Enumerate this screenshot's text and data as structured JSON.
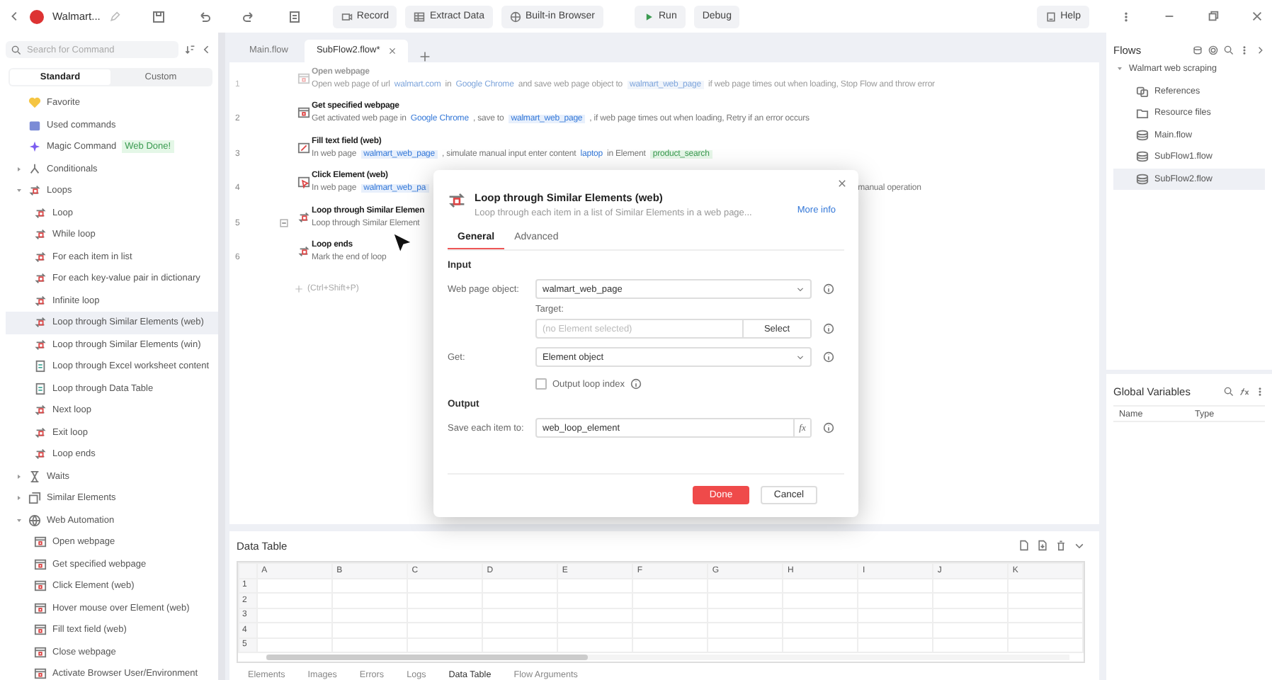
{
  "toolbar": {
    "title": "Walmart...",
    "buttons": [
      {
        "label": "Record",
        "kind": "record"
      },
      {
        "label": "Extract Data",
        "kind": "extract"
      },
      {
        "label": "Built-in Browser",
        "kind": "browser"
      },
      {
        "label": "Run",
        "kind": "run"
      },
      {
        "label": "Debug",
        "kind": "debug"
      }
    ],
    "help": "Help"
  },
  "sidebar": {
    "search": {
      "placeholder": "Search for Command"
    },
    "tabs": [
      {
        "label": "Standard",
        "selected": true
      },
      {
        "label": "Custom",
        "selected": false
      }
    ],
    "items": [
      {
        "kind": "entry",
        "label": "Favorite"
      },
      {
        "kind": "entry",
        "label": "Used commands"
      },
      {
        "kind": "entry",
        "label": "Magic Command",
        "badge": "Web Done!"
      },
      {
        "kind": "group",
        "label": "Conditionals",
        "expanded": false
      },
      {
        "kind": "group",
        "label": "Loops",
        "expanded": true,
        "children": [
          {
            "label": "Loop",
            "selected": false
          },
          {
            "label": "While loop",
            "selected": false
          },
          {
            "label": "For each item in list",
            "selected": false
          },
          {
            "label": "For each key-value pair in dictionary",
            "selected": false
          },
          {
            "label": "Infinite loop",
            "selected": false
          },
          {
            "label": "Loop through Similar Elements (web)",
            "selected": true
          },
          {
            "label": "Loop through Similar Elements (win)",
            "selected": false
          },
          {
            "label": "Loop through Excel worksheet content",
            "selected": false
          },
          {
            "label": "Loop through Data Table",
            "selected": false
          },
          {
            "label": "Next loop",
            "selected": false
          },
          {
            "label": "Exit loop",
            "selected": false
          },
          {
            "label": "Loop ends",
            "selected": false
          }
        ]
      },
      {
        "kind": "group",
        "label": "Waits",
        "expanded": false
      },
      {
        "kind": "group",
        "label": "Similar Elements",
        "expanded": false
      },
      {
        "kind": "group",
        "label": "Web Automation",
        "expanded": true,
        "children": [
          {
            "label": "Open webpage",
            "selected": false
          },
          {
            "label": "Get specified webpage",
            "selected": false
          },
          {
            "label": "Click Element (web)",
            "selected": false
          },
          {
            "label": "Hover mouse over Element (web)",
            "selected": false
          },
          {
            "label": "Fill text field (web)",
            "selected": false
          },
          {
            "label": "Close webpage",
            "selected": false
          },
          {
            "label": "Activate Browser User/Environment",
            "selected": false
          }
        ]
      }
    ]
  },
  "editor": {
    "tabs": [
      {
        "label": "Main.flow",
        "selected": false
      },
      {
        "label": "SubFlow2.flow*",
        "selected": true
      }
    ],
    "steps": [
      {
        "number": "1",
        "title": "Open webpage",
        "disabled": true,
        "parts": [
          {
            "kind": "text",
            "text": "Open web page of url"
          },
          {
            "kind": "link",
            "text": "walmart.com"
          },
          {
            "kind": "text",
            "text": "in"
          },
          {
            "kind": "link",
            "text": "Google Chrome"
          },
          {
            "kind": "text",
            "text": "and save web page object to"
          },
          {
            "kind": "var",
            "text": "walmart_web_page"
          },
          {
            "kind": "text",
            "text": "if web page times out when loading, Stop Flow and throw error"
          }
        ]
      },
      {
        "number": "2",
        "title": "Get specified webpage",
        "disabled": false,
        "parts": [
          {
            "kind": "text",
            "text": "Get activated web page in"
          },
          {
            "kind": "link",
            "text": "Google Chrome"
          },
          {
            "kind": "text",
            "text": ", save to"
          },
          {
            "kind": "var",
            "text": "walmart_web_page"
          },
          {
            "kind": "text",
            "text": ", if web page times out when loading, Retry if an error occurs"
          }
        ]
      },
      {
        "number": "3",
        "title": "Fill text field (web)",
        "disabled": false,
        "parts": [
          {
            "kind": "text",
            "text": "In web page"
          },
          {
            "kind": "var",
            "text": "walmart_web_page"
          },
          {
            "kind": "text",
            "text": ", simulate manual input enter content"
          },
          {
            "kind": "link",
            "text": "laptop"
          },
          {
            "kind": "text",
            "text": "in Element"
          },
          {
            "kind": "element",
            "text": "product_search"
          }
        ]
      },
      {
        "number": "4",
        "title": "Click Element (web)",
        "disabled": false,
        "parts": [
          {
            "kind": "text",
            "text": "In web page"
          },
          {
            "kind": "var",
            "text": "walmart_web_pa"
          },
          {
            "kind": "tail",
            "text": "manual operation"
          }
        ]
      },
      {
        "number": "5",
        "title": "Loop through Similar Elemen",
        "disabled": false,
        "expanded": true,
        "parts": [
          {
            "kind": "text",
            "text": "Loop through Similar Element"
          }
        ]
      },
      {
        "number": "6",
        "title": "Loop ends",
        "disabled": false,
        "parts": [
          {
            "kind": "text",
            "text": "Mark the end of loop"
          }
        ]
      }
    ],
    "add_hint": "(Ctrl+Shift+P)"
  },
  "dialog": {
    "title": "Loop through Similar Elements (web)",
    "subtitle": "Loop through each item in a list of Similar Elements in a web page...",
    "more_info": "More info",
    "tabs": [
      {
        "label": "General",
        "selected": true
      },
      {
        "label": "Advanced",
        "selected": false
      }
    ],
    "input_section": "Input",
    "web_page_object": {
      "label": "Web page object:",
      "value": "walmart_web_page"
    },
    "target": {
      "label": "Target:",
      "placeholder": "(no Element selected)",
      "button": "Select"
    },
    "get": {
      "label": "Get:",
      "value": "Element object"
    },
    "output_loop_index": {
      "label": "Output loop index",
      "checked": false
    },
    "output_section": "Output",
    "save_to": {
      "label": "Save each item to:",
      "value": "web_loop_element",
      "fx": "fx"
    },
    "buttons": {
      "done": "Done",
      "cancel": "Cancel"
    }
  },
  "bottom_panel": {
    "title": "Data Table",
    "table": {
      "columns": [
        "A",
        "B",
        "C",
        "D",
        "E",
        "F",
        "G",
        "H",
        "I",
        "J",
        "K"
      ],
      "rows": [
        "1",
        "2",
        "3",
        "4",
        "5"
      ]
    },
    "tabs": [
      {
        "label": "Elements",
        "selected": false
      },
      {
        "label": "Images",
        "selected": false
      },
      {
        "label": "Errors",
        "selected": false
      },
      {
        "label": "Logs",
        "selected": false
      },
      {
        "label": "Data Table",
        "selected": true
      },
      {
        "label": "Flow Arguments",
        "selected": false
      }
    ]
  },
  "flows": {
    "title": "Flows",
    "tree": [
      {
        "label": "Walmart web scraping",
        "expanded": true,
        "children": [
          {
            "label": "References",
            "selected": false
          },
          {
            "label": "Resource files",
            "selected": false
          },
          {
            "label": "Main.flow",
            "selected": false
          },
          {
            "label": "SubFlow1.flow",
            "selected": false
          },
          {
            "label": "SubFlow2.flow",
            "selected": true
          }
        ]
      }
    ]
  },
  "variables": {
    "title": "Global Variables",
    "columns": [
      "Name",
      "Type"
    ]
  }
}
